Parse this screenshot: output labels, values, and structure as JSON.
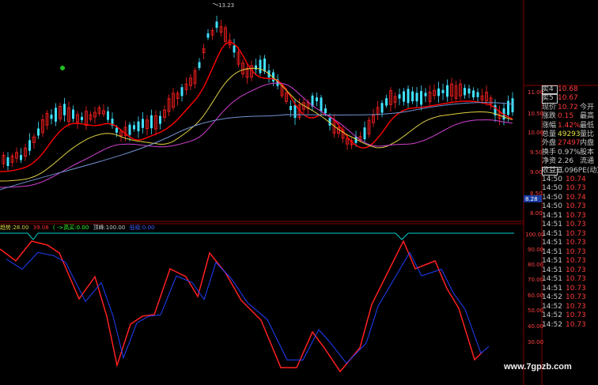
{
  "colors": {
    "up": "#ff2020",
    "down": "#40e0ff",
    "ma5": "#ff0000",
    "ma10": "#e0d040",
    "ma20": "#d040d0",
    "ma60": "#7090d0",
    "kdj_k": "#ff2020",
    "kdj_d": "#2040ff",
    "hline": "#00d0d0",
    "grid": "#800000"
  },
  "chart": {
    "high_marker": "13.23"
  },
  "price_axis": {
    "labels": [
      "11.00",
      "10.50",
      "10.00",
      "9.50",
      "9.00",
      "8.50",
      "8.00"
    ],
    "current_marker": "8.28"
  },
  "kdj_axis": {
    "labels": [
      "100.00",
      "90.00",
      "80.00",
      "70.00",
      "60.00",
      "50.00",
      "40.00",
      "30.00"
    ]
  },
  "indicator_legend": {
    "items": [
      {
        "text": "趋势:28.00",
        "color": "#e0d040"
      },
      {
        "text": "39.08",
        "color": "#ff3030"
      },
      {
        "text": "( ->高买:0.00",
        "color": "#30ff30"
      },
      {
        "text": "顶峰:100.00",
        "color": "#c8c8c8"
      },
      {
        "text": "低吸:0.00",
        "color": "#4060ff"
      }
    ]
  },
  "quote": {
    "rows": [
      {
        "label": "卖4",
        "value": "10.68",
        "value_color": "#ff3b3b",
        "extra": "",
        "boxed": true
      },
      {
        "label": "卖5",
        "value": "10.67",
        "value_color": "#ff3b3b",
        "extra": "",
        "boxed": true
      },
      {
        "label": "现价",
        "value": "10.72",
        "value_color": "#ff3b3b",
        "extra": "今开",
        "boxed": false
      },
      {
        "label": "涨跌",
        "value": "0.15",
        "value_color": "#ff3b3b",
        "extra": "最高",
        "boxed": false
      },
      {
        "label": "涨幅",
        "value": "1.42%",
        "value_color": "#ff3b3b",
        "extra": "最低",
        "boxed": false
      },
      {
        "label": "总量",
        "value": "49293",
        "value_color": "#e0e040",
        "extra": "量比",
        "boxed": false
      },
      {
        "label": "外盘",
        "value": "27497",
        "value_color": "#ff3b3b",
        "extra": "内盘",
        "boxed": false
      },
      {
        "label": "换手",
        "value": "0.97%",
        "value_color": "#c8c8c8",
        "extra": "股本",
        "boxed": false
      },
      {
        "label": "净资",
        "value": "2.26",
        "value_color": "#c8c8c8",
        "extra": "流通",
        "boxed": false
      },
      {
        "label": "收益三",
        "value": "0.096",
        "value_color": "#c8c8c8",
        "extra": "PE(动)",
        "boxed": true
      }
    ],
    "ticks": [
      {
        "time": "14:50",
        "price": "10.74"
      },
      {
        "time": "14:50",
        "price": "10.73"
      },
      {
        "time": "14:50",
        "price": "10.74"
      },
      {
        "time": "14:50",
        "price": "10.73"
      },
      {
        "time": "14:51",
        "price": "10.73"
      },
      {
        "time": "14:51",
        "price": "10.73"
      },
      {
        "time": "14:51",
        "price": "10.73"
      },
      {
        "time": "14:51",
        "price": "10.73"
      },
      {
        "time": "14:51",
        "price": "10.73"
      },
      {
        "time": "14:51",
        "price": "10.73"
      },
      {
        "time": "14:51",
        "price": "10.73"
      },
      {
        "time": "14:51",
        "price": "10.73"
      },
      {
        "time": "14:51",
        "price": "10.73"
      },
      {
        "time": "14:52",
        "price": "10.73"
      },
      {
        "time": "14:52",
        "price": "10.73"
      },
      {
        "time": "14:52",
        "price": "10.73"
      },
      {
        "time": "14:52",
        "price": "10.73"
      }
    ]
  },
  "watermark": "www.7gpzb.com"
}
